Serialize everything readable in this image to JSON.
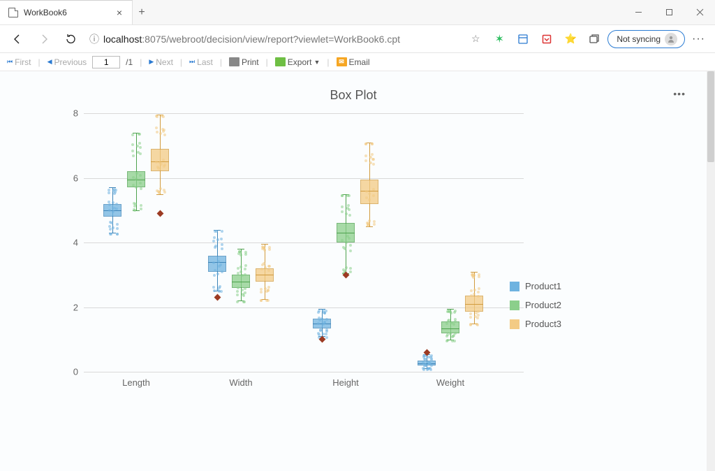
{
  "window": {
    "tab_title": "WorkBook6",
    "sync_label": "Not syncing"
  },
  "addressbar": {
    "info_icon": "ⓘ",
    "url_host": "localhost",
    "url_rest": ":8075/webroot/decision/view/report?viewlet=WorkBook6.cpt"
  },
  "report_toolbar": {
    "first": "First",
    "previous": "Previous",
    "page_value": "1",
    "page_total": "/1",
    "next": "Next",
    "last": "Last",
    "print": "Print",
    "export": "Export",
    "email": "Email"
  },
  "legend": {
    "items": [
      "Product1",
      "Product2",
      "Product3"
    ],
    "colors": [
      "#6fb3e0",
      "#8bcf8b",
      "#f3cb84"
    ]
  },
  "chart_data": {
    "type": "box",
    "title": "Box Plot",
    "categories": [
      "Length",
      "Width",
      "Height",
      "Weight"
    ],
    "ylim": [
      0,
      8
    ],
    "yticks": [
      0,
      2,
      4,
      6,
      8
    ],
    "series": [
      {
        "name": "Product1",
        "color": "#6fb3e0",
        "boxes": [
          {
            "min": 4.3,
            "q1": 4.8,
            "median": 5.0,
            "q3": 5.2,
            "max": 5.7,
            "outliers": []
          },
          {
            "min": 2.5,
            "q1": 3.1,
            "median": 3.4,
            "q3": 3.6,
            "max": 4.4,
            "outliers": [
              2.3
            ]
          },
          {
            "min": 1.1,
            "q1": 1.35,
            "median": 1.5,
            "q3": 1.65,
            "max": 1.95,
            "outliers": [
              1.0
            ]
          },
          {
            "min": 0.1,
            "q1": 0.2,
            "median": 0.25,
            "q3": 0.35,
            "max": 0.55,
            "outliers": [
              0.6
            ]
          }
        ]
      },
      {
        "name": "Product2",
        "color": "#8bcf8b",
        "boxes": [
          {
            "min": 5.0,
            "q1": 5.7,
            "median": 5.95,
            "q3": 6.2,
            "max": 7.4,
            "outliers": []
          },
          {
            "min": 2.2,
            "q1": 2.6,
            "median": 2.8,
            "q3": 3.0,
            "max": 3.8,
            "outliers": []
          },
          {
            "min": 3.05,
            "q1": 4.0,
            "median": 4.3,
            "q3": 4.6,
            "max": 5.5,
            "outliers": [
              3.0
            ]
          },
          {
            "min": 1.0,
            "q1": 1.2,
            "median": 1.35,
            "q3": 1.55,
            "max": 1.95,
            "outliers": []
          }
        ]
      },
      {
        "name": "Product3",
        "color": "#f3cb84",
        "boxes": [
          {
            "min": 5.5,
            "q1": 6.2,
            "median": 6.5,
            "q3": 6.9,
            "max": 7.95,
            "outliers": [
              4.9
            ]
          },
          {
            "min": 2.25,
            "q1": 2.8,
            "median": 3.0,
            "q3": 3.2,
            "max": 3.95,
            "outliers": []
          },
          {
            "min": 4.5,
            "q1": 5.2,
            "median": 5.6,
            "q3": 5.95,
            "max": 7.1,
            "outliers": []
          },
          {
            "min": 1.5,
            "q1": 1.85,
            "median": 2.1,
            "q3": 2.35,
            "max": 3.1,
            "outliers": []
          }
        ]
      }
    ]
  }
}
